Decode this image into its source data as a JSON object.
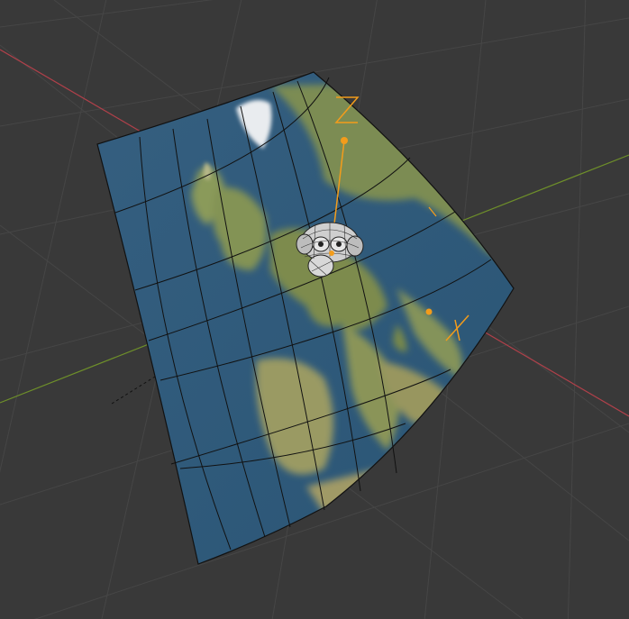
{
  "viewport": {
    "background_color": "#393939",
    "grid_color": "#464646",
    "x_axis_color": "#b0404a",
    "y_axis_color": "#6e8f2a",
    "selection_color": "#f39c1b"
  },
  "scene": {
    "plane": {
      "texture": "europe-map",
      "segments_u": 6,
      "segments_v": 6,
      "ocean_color": "#2f5f7f",
      "land_color": "#7a8a4a"
    },
    "object": "suzanne-monkey-mesh",
    "empties": [
      "z-axis-empty",
      "axis-empty"
    ]
  }
}
